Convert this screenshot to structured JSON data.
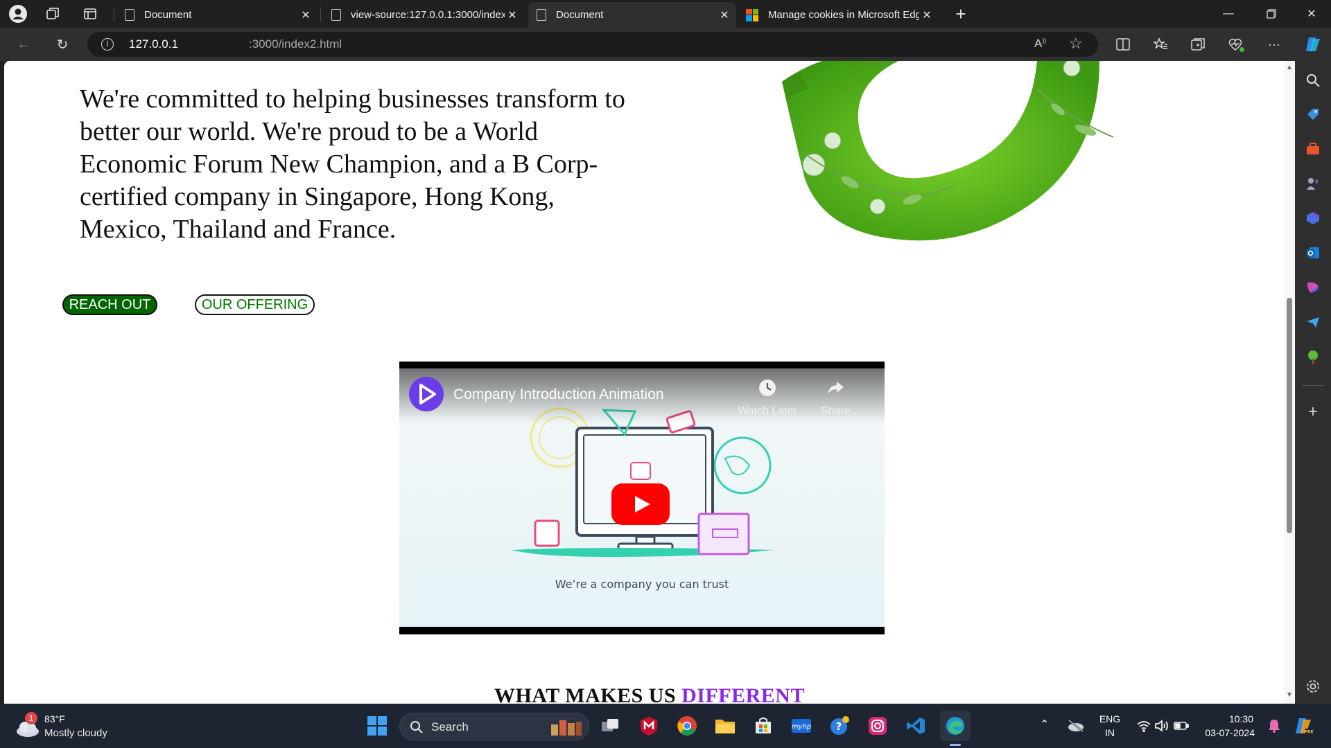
{
  "browser": {
    "tabs": [
      {
        "title": "Document",
        "active": false
      },
      {
        "title": "view-source:127.0.0.1:3000/index",
        "active": false
      },
      {
        "title": "Document",
        "active": true
      },
      {
        "title": "Manage cookies in Microsoft Edge",
        "active": false
      }
    ],
    "url_host": "127.0.0.1",
    "url_path": ":3000/index2.html"
  },
  "page": {
    "hero_text": "We're committed to helping businesses transform to better our world. We're proud to be a World Economic Forum New Champion, and a B Corp-certified company in Singapore, Hong Kong, Mexico, Thailand and France.",
    "buttons": {
      "reach_out": "REACH OUT",
      "our_offering": "OUR OFFERING"
    },
    "video": {
      "title": "Company Introduction Animation",
      "watch_later": "Watch Later",
      "share": "Share",
      "caption": "We’re a company you can trust"
    },
    "section_heading": {
      "main": "WHAT MAKES US ",
      "highlight": "DIFFERENT"
    }
  },
  "taskbar": {
    "weather_temp": "83°F",
    "weather_desc": "Mostly cloudy",
    "weather_badge": "1",
    "search": "Search",
    "lang_top": "ENG",
    "lang_bottom": "IN",
    "time": "10:30",
    "date": "03-07-2024"
  },
  "colors": {
    "reach_out_bg": "#006400",
    "offering_text": "#007a00",
    "heading_highlight": "#8a2be2",
    "youtube_red": "#ff0000"
  }
}
